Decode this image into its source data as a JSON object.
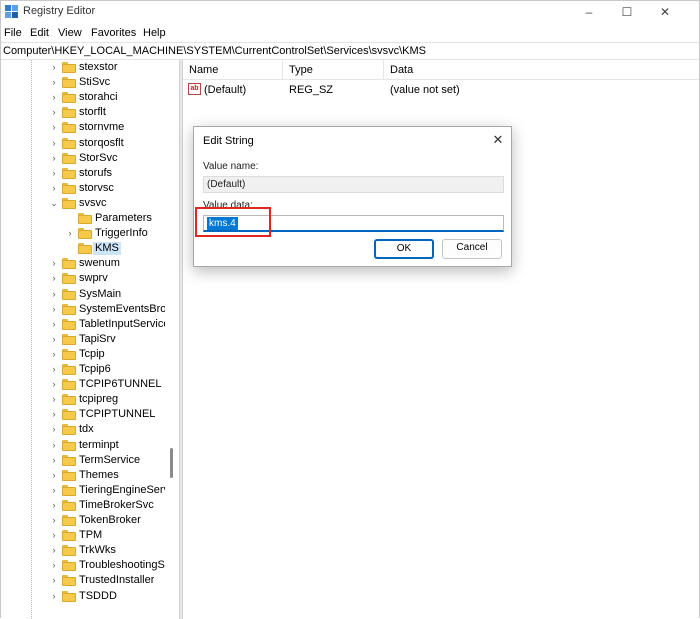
{
  "window": {
    "title": "Registry Editor",
    "minimize": "–",
    "maximize": "☐",
    "close": "✕"
  },
  "menu": [
    "File",
    "Edit",
    "View",
    "Favorites",
    "Help"
  ],
  "address": "Computer\\HKEY_LOCAL_MACHINE\\SYSTEM\\CurrentControlSet\\Services\\svsvc\\KMS",
  "tree": [
    {
      "label": "stexstor",
      "expander": "›",
      "level": 1
    },
    {
      "label": "StiSvc",
      "expander": "›",
      "level": 1
    },
    {
      "label": "storahci",
      "expander": "›",
      "level": 1
    },
    {
      "label": "storflt",
      "expander": "›",
      "level": 1
    },
    {
      "label": "stornvme",
      "expander": "›",
      "level": 1
    },
    {
      "label": "storqosflt",
      "expander": "›",
      "level": 1
    },
    {
      "label": "StorSvc",
      "expander": "›",
      "level": 1
    },
    {
      "label": "storufs",
      "expander": "›",
      "level": 1
    },
    {
      "label": "storvsc",
      "expander": "›",
      "level": 1
    },
    {
      "label": "svsvc",
      "expander": "⌄",
      "level": 1
    },
    {
      "label": "Parameters",
      "expander": "",
      "level": 2
    },
    {
      "label": "TriggerInfo",
      "expander": "›",
      "level": 2
    },
    {
      "label": "KMS",
      "expander": "",
      "level": 2,
      "selected": true
    },
    {
      "label": "swenum",
      "expander": "›",
      "level": 1
    },
    {
      "label": "swprv",
      "expander": "›",
      "level": 1
    },
    {
      "label": "SysMain",
      "expander": "›",
      "level": 1
    },
    {
      "label": "SystemEventsBroke",
      "expander": "›",
      "level": 1
    },
    {
      "label": "TabletInputService",
      "expander": "›",
      "level": 1
    },
    {
      "label": "TapiSrv",
      "expander": "›",
      "level": 1
    },
    {
      "label": "Tcpip",
      "expander": "›",
      "level": 1
    },
    {
      "label": "Tcpip6",
      "expander": "›",
      "level": 1
    },
    {
      "label": "TCPIP6TUNNEL",
      "expander": "›",
      "level": 1
    },
    {
      "label": "tcpipreg",
      "expander": "›",
      "level": 1
    },
    {
      "label": "TCPIPTUNNEL",
      "expander": "›",
      "level": 1
    },
    {
      "label": "tdx",
      "expander": "›",
      "level": 1
    },
    {
      "label": "terminpt",
      "expander": "›",
      "level": 1
    },
    {
      "label": "TermService",
      "expander": "›",
      "level": 1
    },
    {
      "label": "Themes",
      "expander": "›",
      "level": 1
    },
    {
      "label": "TieringEngineServi",
      "expander": "›",
      "level": 1
    },
    {
      "label": "TimeBrokerSvc",
      "expander": "›",
      "level": 1
    },
    {
      "label": "TokenBroker",
      "expander": "›",
      "level": 1
    },
    {
      "label": "TPM",
      "expander": "›",
      "level": 1
    },
    {
      "label": "TrkWks",
      "expander": "›",
      "level": 1
    },
    {
      "label": "TroubleshootingSv",
      "expander": "›",
      "level": 1
    },
    {
      "label": "TrustedInstaller",
      "expander": "›",
      "level": 1
    },
    {
      "label": "TSDDD",
      "expander": "›",
      "level": 1
    }
  ],
  "list": {
    "columns": [
      "Name",
      "Type",
      "Data"
    ],
    "rows": [
      {
        "icon": "ab",
        "name": "(Default)",
        "type": "REG_SZ",
        "data": "(value not set)"
      }
    ]
  },
  "dialog": {
    "title": "Edit String",
    "close": "✕",
    "value_name_label": "Value name:",
    "value_name": "(Default)",
    "value_data_label": "Value data:",
    "value_data": "kms.4",
    "ok": "OK",
    "cancel": "Cancel",
    "highlight_color": "#e0261f",
    "accent_color": "#0067c0"
  },
  "colors": {
    "folder": "#f5c94a",
    "selection": "#cce4f7"
  }
}
